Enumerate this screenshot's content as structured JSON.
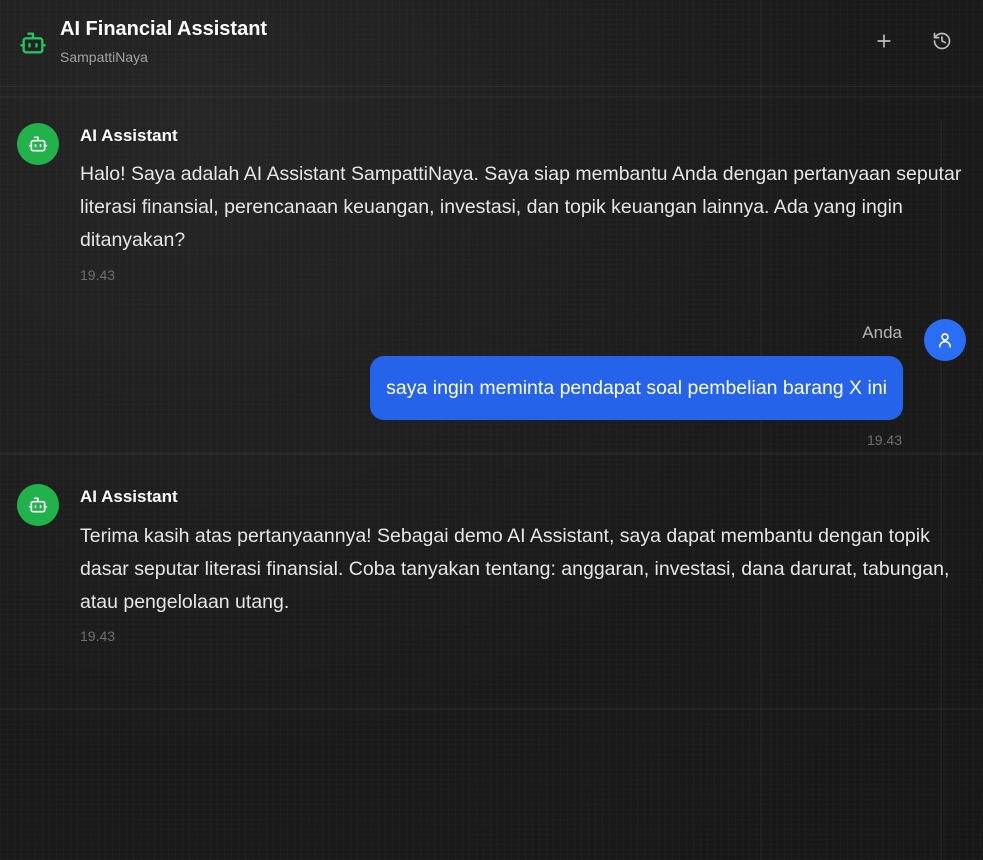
{
  "header": {
    "title": "AI Financial Assistant",
    "subtitle": "SampattiNaya",
    "icon": "robot-icon",
    "actions": [
      {
        "name": "new-chat",
        "icon": "plus-icon"
      },
      {
        "name": "history",
        "icon": "history-icon"
      }
    ]
  },
  "colors": {
    "background": "#1c1c1c",
    "bot_accent": "#22b24c",
    "user_accent": "#2563eb"
  },
  "messages": [
    {
      "sender": "AI Assistant",
      "text": "Halo! Saya adalah AI Assistant SampattiNaya. Saya siap membantu Anda dengan pertanyaan seputar literasi finansial, perencanaan keuangan, investasi, dan topik keuangan lainnya. Ada yang ingin ditanyakan?",
      "time": "19.43"
    },
    {
      "sender": "Anda",
      "text": "saya ingin meminta pendapat soal pembelian barang X ini",
      "time": "19.43"
    },
    {
      "sender": "AI Assistant",
      "text": "Terima kasih atas pertanyaannya! Sebagai demo AI Assistant, saya dapat membantu dengan topik dasar seputar literasi finansial. Coba tanyakan tentang: anggaran, investasi, dana darurat, tabungan, atau pengelolaan utang.",
      "time": "19.43"
    }
  ]
}
